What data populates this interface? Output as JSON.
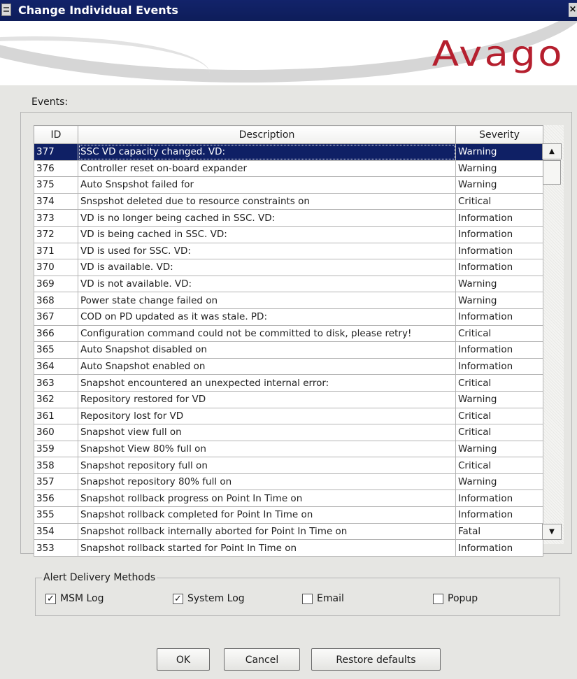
{
  "window": {
    "title": "Change Individual Events",
    "close_label": "×"
  },
  "header": {
    "logo_text": "Avago",
    "logo_color": "#b51f2e"
  },
  "events_label": "Events:",
  "table": {
    "columns": [
      "ID",
      "Description",
      "Severity"
    ],
    "rows": [
      {
        "id": "377",
        "description": "SSC VD capacity changed. VD:",
        "severity": "Warning",
        "selected": true
      },
      {
        "id": "376",
        "description": "Controller reset on-board expander",
        "severity": "Warning"
      },
      {
        "id": "375",
        "description": "Auto Snspshot failed for",
        "severity": "Warning"
      },
      {
        "id": "374",
        "description": "Snspshot deleted due to resource constraints on",
        "severity": "Critical"
      },
      {
        "id": "373",
        "description": "VD is no longer being cached in SSC. VD:",
        "severity": "Information"
      },
      {
        "id": "372",
        "description": "VD is being cached in SSC. VD:",
        "severity": "Information"
      },
      {
        "id": "371",
        "description": "VD is used for SSC. VD:",
        "severity": "Information"
      },
      {
        "id": "370",
        "description": "VD is available. VD:",
        "severity": "Information"
      },
      {
        "id": "369",
        "description": "VD is not available. VD:",
        "severity": "Warning"
      },
      {
        "id": "368",
        "description": "Power state change failed on",
        "severity": "Warning"
      },
      {
        "id": "367",
        "description": "COD on PD updated as it was stale. PD:",
        "severity": "Information"
      },
      {
        "id": "366",
        "description": "Configuration command could not be committed to disk, please retry!",
        "severity": "Critical"
      },
      {
        "id": "365",
        "description": "Auto Snapshot disabled on",
        "severity": "Information"
      },
      {
        "id": "364",
        "description": "Auto Snapshot enabled on",
        "severity": "Information"
      },
      {
        "id": "363",
        "description": "Snapshot encountered an unexpected internal error:",
        "severity": "Critical"
      },
      {
        "id": "362",
        "description": "Repository restored for VD",
        "severity": "Warning"
      },
      {
        "id": "361",
        "description": "Repository lost for VD",
        "severity": "Critical"
      },
      {
        "id": "360",
        "description": "Snapshot view full on",
        "severity": "Critical"
      },
      {
        "id": "359",
        "description": "Snapshot View 80% full on",
        "severity": "Warning"
      },
      {
        "id": "358",
        "description": "Snapshot repository full on",
        "severity": "Critical"
      },
      {
        "id": "357",
        "description": "Snapshot repository 80% full on",
        "severity": "Warning"
      },
      {
        "id": "356",
        "description": "Snapshot rollback progress on Point In Time on",
        "severity": "Information"
      },
      {
        "id": "355",
        "description": "Snapshot rollback completed for Point In Time on",
        "severity": "Information"
      },
      {
        "id": "354",
        "description": "Snapshot rollback internally aborted for Point In Time on",
        "severity": "Fatal"
      },
      {
        "id": "353",
        "description": "Snapshot rollback started for Point In Time on",
        "severity": "Information"
      }
    ]
  },
  "scrollbar": {
    "up_icon": "▲",
    "down_icon": "▼"
  },
  "alert_delivery": {
    "legend": "Alert Delivery Methods",
    "options": [
      {
        "label": "MSM Log",
        "checked": true
      },
      {
        "label": "System Log",
        "checked": true
      },
      {
        "label": "Email",
        "checked": false
      },
      {
        "label": "Popup",
        "checked": false
      }
    ]
  },
  "buttons": {
    "ok": "OK",
    "cancel": "Cancel",
    "restore": "Restore defaults"
  },
  "colors": {
    "selection": "#0f2065",
    "titlebar": "#12236a"
  }
}
